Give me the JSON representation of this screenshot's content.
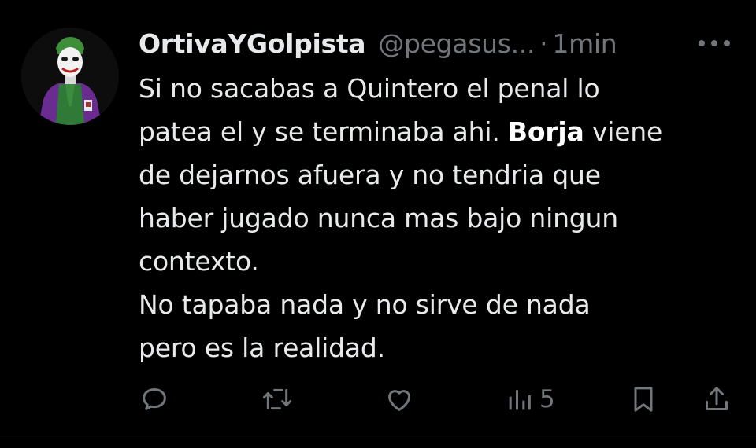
{
  "tweet": {
    "author_name": "OrtivaYGolpista",
    "handle": "@pegasus...",
    "separator": "·",
    "time": "1min",
    "body_lines": [
      {
        "before": "Si no sacabas a Quintero el penal lo",
        "bold": "",
        "after": ""
      },
      {
        "before": "patea el y se terminaba ahi. ",
        "bold": "Borja",
        "after": " viene"
      },
      {
        "before": "de dejarnos afuera y no tendria que",
        "bold": "",
        "after": ""
      },
      {
        "before": "haber jugado nunca mas bajo ningun",
        "bold": "",
        "after": ""
      },
      {
        "before": "contexto.",
        "bold": "",
        "after": ""
      },
      {
        "before": "No tapaba nada y no sirve de nada",
        "bold": "",
        "after": ""
      },
      {
        "before": "pero es la realidad.",
        "bold": "",
        "after": ""
      }
    ]
  },
  "actions": {
    "reply_icon": "speech-bubble-icon",
    "retweet_icon": "retweet-icon",
    "like_icon": "heart-icon",
    "views_icon": "bar-chart-icon",
    "views_count": "5",
    "bookmark_icon": "bookmark-icon",
    "share_icon": "share-upload-icon",
    "more_icon": "more-horizontal-icon"
  },
  "colors": {
    "background": "#000000",
    "text": "#e7e9ea",
    "muted": "#71767b",
    "avatar_suit": "#6a2c91",
    "avatar_vest": "#2e7d32"
  }
}
